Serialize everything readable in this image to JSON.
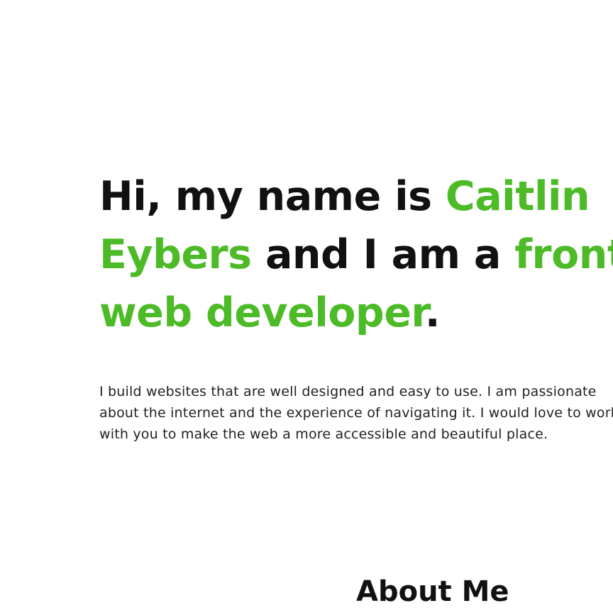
{
  "hero": {
    "line1": {
      "prefix": "Hi, my name is ",
      "name_first": "Caitlin"
    },
    "line2": {
      "name_last": "Eybers",
      "middle": " and I am a ",
      "role_start": "front-end"
    },
    "line3": {
      "role_end": "web developer",
      "period": "."
    }
  },
  "intro": {
    "lines": [
      "I build websites that are well designed and easy to use. I am passionate",
      "about the internet and the experience of navigating it. I would love to work",
      "with you to make the web a more accessible and beautiful place."
    ]
  },
  "about": {
    "heading": "About Me"
  },
  "colors": {
    "accent": "#4dba27",
    "text": "#111111",
    "background": "#ffffff"
  }
}
